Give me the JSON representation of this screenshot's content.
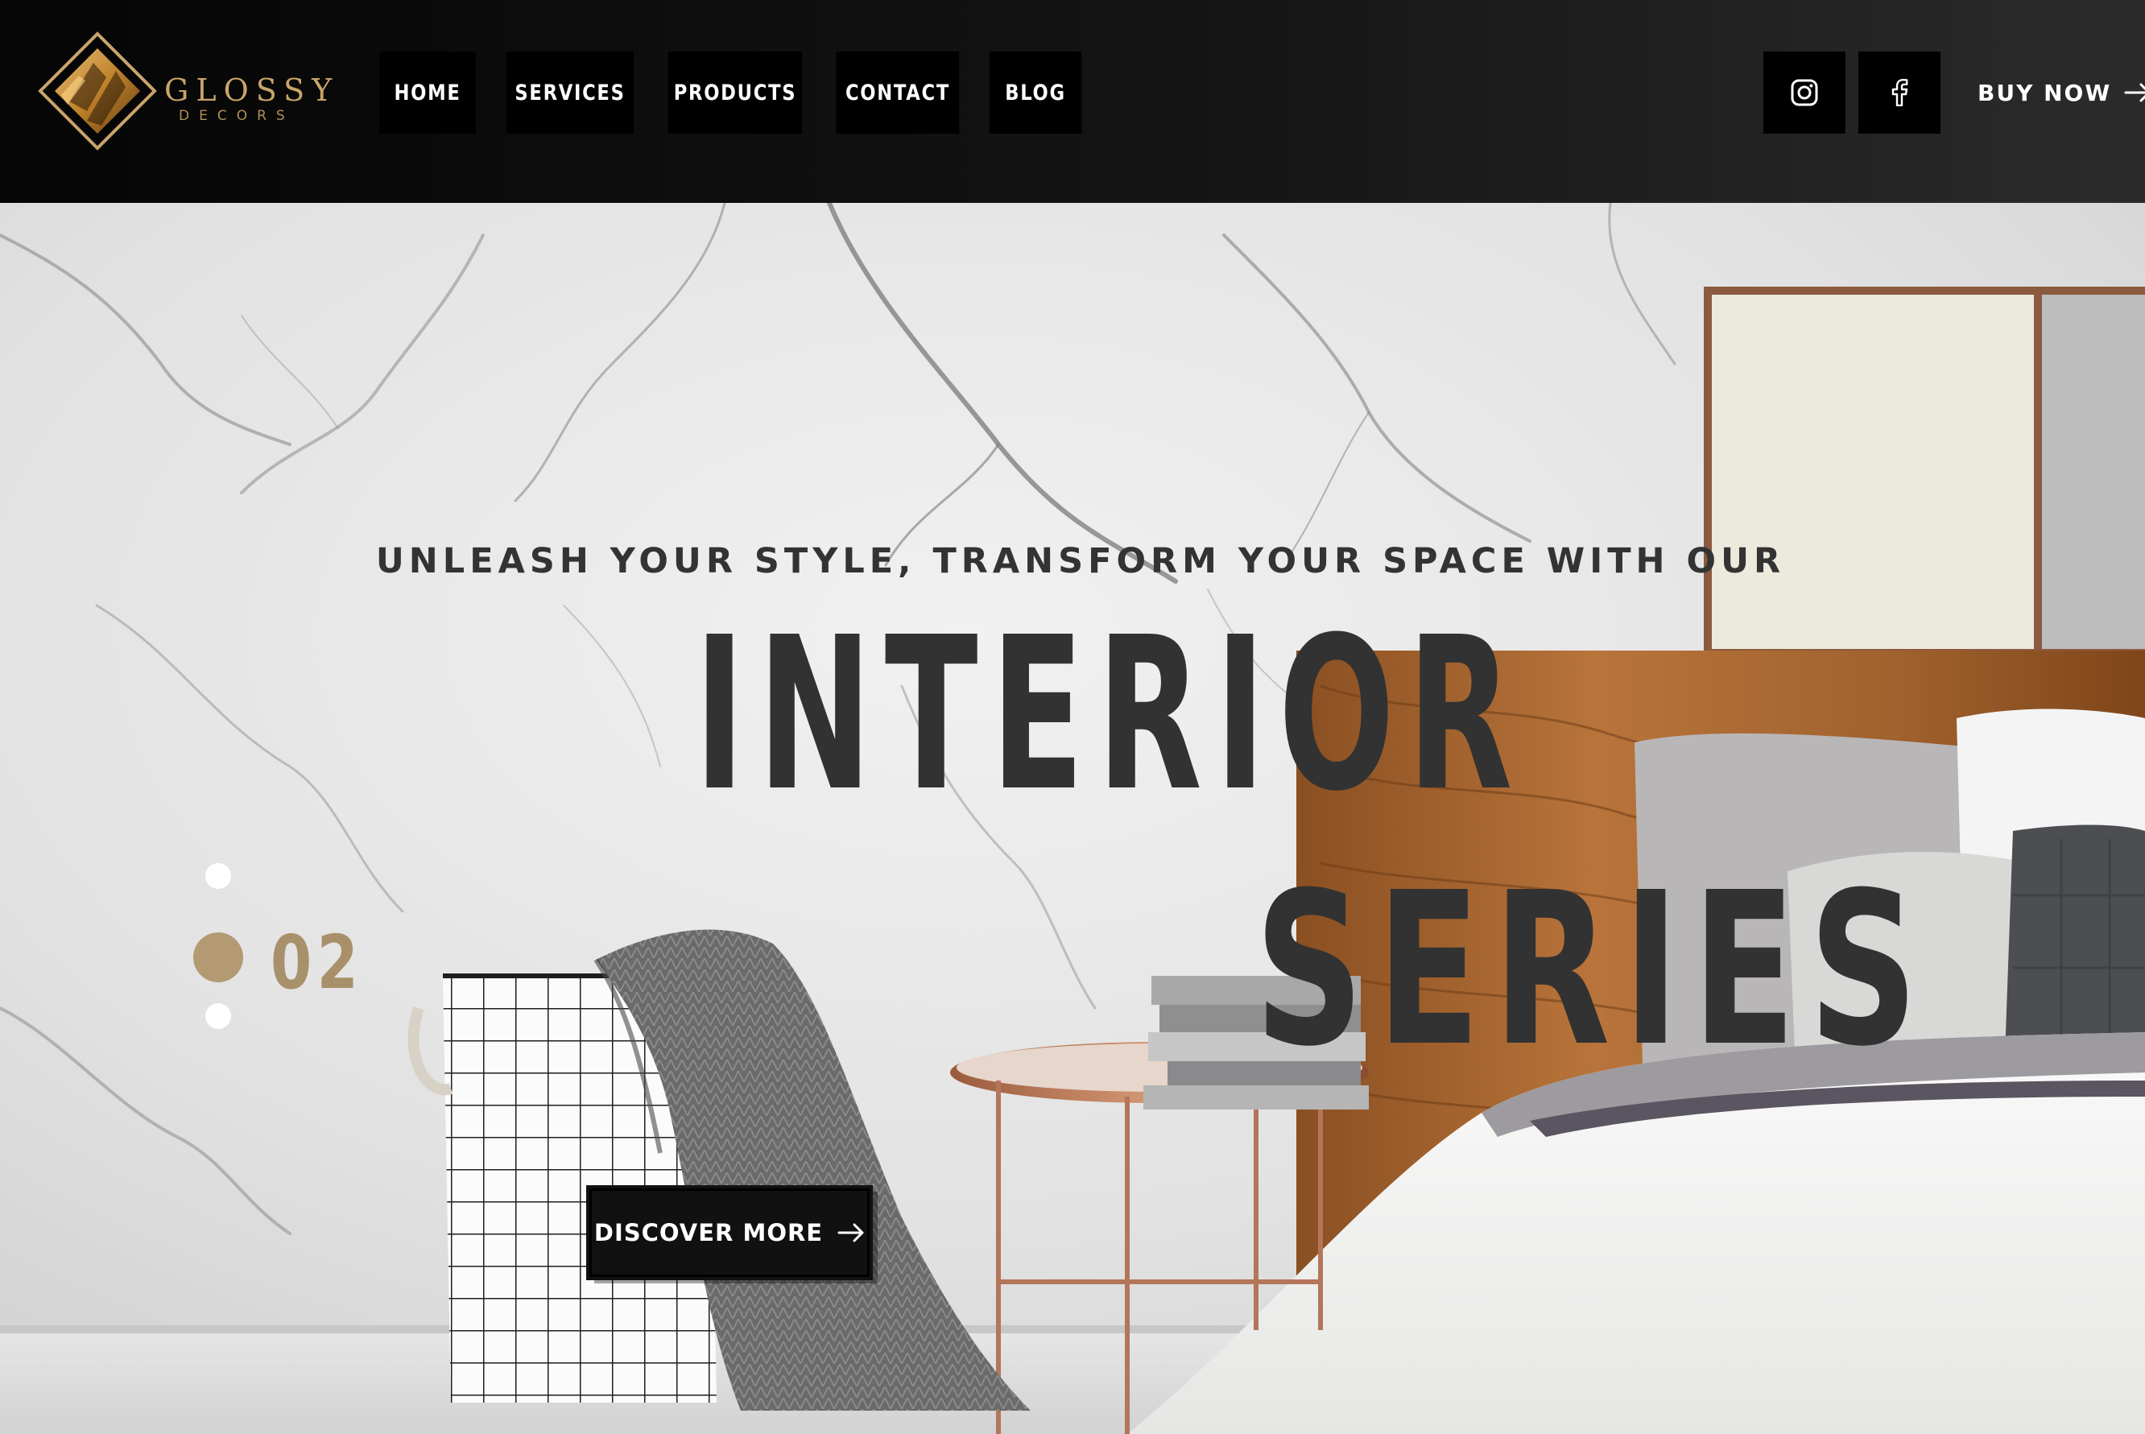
{
  "brand": {
    "name": "GLOSSY",
    "subtitle": "DECORS"
  },
  "nav": {
    "items": [
      {
        "label": "HOME"
      },
      {
        "label": "SERVICES"
      },
      {
        "label": "PRODUCTS"
      },
      {
        "label": "CONTACT"
      },
      {
        "label": "BLOG"
      }
    ]
  },
  "social": {
    "icons": [
      "instagram-icon",
      "facebook-icon"
    ]
  },
  "header_cta": {
    "label": "BUY NOW",
    "icon": "arrow-right-icon"
  },
  "hero": {
    "tagline": "UNLEASH YOUR STYLE, TRANSFORM YOUR SPACE WITH OUR",
    "title_line_1": "INTERIOR",
    "title_line_2": "SERIES",
    "cta_label": "DISCOVER MORE",
    "cta_icon": "arrow-right-icon",
    "slide_number": "02",
    "slide_total_dots": 3,
    "active_slide_index": 1
  },
  "colors": {
    "header_bg": "#0a0a0a",
    "accent_gold": "#b39a73",
    "logo_gold": "#c9a46a",
    "title_text": "#323232",
    "button_bg": "#111111",
    "marble_wall": "#dcdcdc",
    "wood_headboard": "#a0642e"
  }
}
